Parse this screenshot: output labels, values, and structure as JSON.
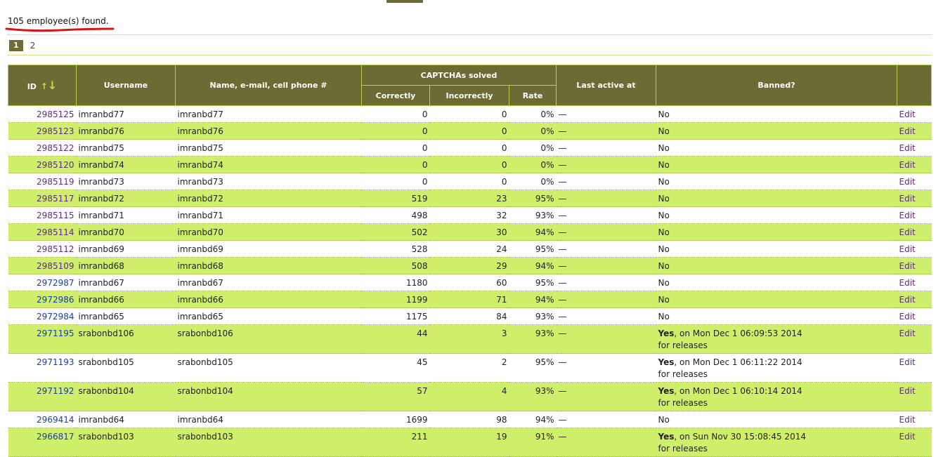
{
  "summary": {
    "found_text": "105 employee(s) found."
  },
  "pagination": {
    "current": "1",
    "pages": [
      "2"
    ]
  },
  "table": {
    "headers": {
      "id": "ID",
      "sort_up": "↑",
      "sort_down": "↓",
      "username": "Username",
      "name": "Name, e-mail, cell phone #",
      "captchas": "CAPTCHAs solved",
      "correctly": "Correctly",
      "incorrectly": "Incorrectly",
      "rate": "Rate",
      "last_active": "Last active at",
      "banned": "Banned?"
    },
    "edit_label": "Edit",
    "rows": [
      {
        "id": "2985125",
        "username": "imranbd77",
        "name": "imranbd77",
        "correct": "0",
        "incorrect": "0",
        "rate": "0%",
        "last": "—",
        "banned": "No",
        "visited": true
      },
      {
        "id": "2985123",
        "username": "imranbd76",
        "name": "imranbd76",
        "correct": "0",
        "incorrect": "0",
        "rate": "0%",
        "last": "—",
        "banned": "No",
        "visited": true
      },
      {
        "id": "2985122",
        "username": "imranbd75",
        "name": "imranbd75",
        "correct": "0",
        "incorrect": "0",
        "rate": "0%",
        "last": "—",
        "banned": "No",
        "visited": true
      },
      {
        "id": "2985120",
        "username": "imranbd74",
        "name": "imranbd74",
        "correct": "0",
        "incorrect": "0",
        "rate": "0%",
        "last": "—",
        "banned": "No",
        "visited": true
      },
      {
        "id": "2985119",
        "username": "imranbd73",
        "name": "imranbd73",
        "correct": "0",
        "incorrect": "0",
        "rate": "0%",
        "last": "—",
        "banned": "No",
        "visited": true
      },
      {
        "id": "2985117",
        "username": "imranbd72",
        "name": "imranbd72",
        "correct": "519",
        "incorrect": "23",
        "rate": "95%",
        "last": "—",
        "banned": "No",
        "visited": true
      },
      {
        "id": "2985115",
        "username": "imranbd71",
        "name": "imranbd71",
        "correct": "498",
        "incorrect": "32",
        "rate": "93%",
        "last": "—",
        "banned": "No",
        "visited": true
      },
      {
        "id": "2985114",
        "username": "imranbd70",
        "name": "imranbd70",
        "correct": "502",
        "incorrect": "30",
        "rate": "94%",
        "last": "—",
        "banned": "No",
        "visited": true
      },
      {
        "id": "2985112",
        "username": "imranbd69",
        "name": "imranbd69",
        "correct": "528",
        "incorrect": "24",
        "rate": "95%",
        "last": "—",
        "banned": "No",
        "visited": true
      },
      {
        "id": "2985109",
        "username": "imranbd68",
        "name": "imranbd68",
        "correct": "508",
        "incorrect": "29",
        "rate": "94%",
        "last": "—",
        "banned": "No",
        "visited": true
      },
      {
        "id": "2972987",
        "username": "imranbd67",
        "name": "imranbd67",
        "correct": "1180",
        "incorrect": "60",
        "rate": "95%",
        "last": "—",
        "banned": "No",
        "visited": false
      },
      {
        "id": "2972986",
        "username": "imranbd66",
        "name": "imranbd66",
        "correct": "1199",
        "incorrect": "71",
        "rate": "94%",
        "last": "—",
        "banned": "No",
        "visited": false
      },
      {
        "id": "2972984",
        "username": "imranbd65",
        "name": "imranbd65",
        "correct": "1175",
        "incorrect": "84",
        "rate": "93%",
        "last": "—",
        "banned": "No",
        "visited": false
      },
      {
        "id": "2971195",
        "username": "srabonbd106",
        "name": "srabonbd106",
        "correct": "44",
        "incorrect": "3",
        "rate": "93%",
        "last": "—",
        "banned_yes": "Yes",
        "banned_detail": ", on Mon Dec 1 06:09:53 2014",
        "banned_reason": "for releases",
        "visited": false
      },
      {
        "id": "2971193",
        "username": "srabonbd105",
        "name": "srabonbd105",
        "correct": "45",
        "incorrect": "2",
        "rate": "95%",
        "last": "—",
        "banned_yes": "Yes",
        "banned_detail": ", on Mon Dec 1 06:11:22 2014",
        "banned_reason": "for releases",
        "visited": false
      },
      {
        "id": "2971192",
        "username": "srabonbd104",
        "name": "srabonbd104",
        "correct": "57",
        "incorrect": "4",
        "rate": "93%",
        "last": "—",
        "banned_yes": "Yes",
        "banned_detail": ", on Mon Dec 1 06:10:14 2014",
        "banned_reason": "for releases",
        "visited": false
      },
      {
        "id": "2969414",
        "username": "imranbd64",
        "name": "imranbd64",
        "correct": "1699",
        "incorrect": "98",
        "rate": "94%",
        "last": "—",
        "banned": "No",
        "visited": false
      },
      {
        "id": "2966817",
        "username": "srabonbd103",
        "name": "srabonbd103",
        "correct": "211",
        "incorrect": "19",
        "rate": "91%",
        "last": "—",
        "banned_yes": "Yes",
        "banned_detail": ", on Sun Nov 30 15:08:45 2014",
        "banned_reason": "for releases",
        "visited": false
      }
    ]
  },
  "colors": {
    "header_bg": "#6b6b33",
    "row_alt": "#cfee6a",
    "link_visited": "#5e2a8a",
    "link": "#1a3ca8",
    "annotation_red": "#d8141b"
  }
}
